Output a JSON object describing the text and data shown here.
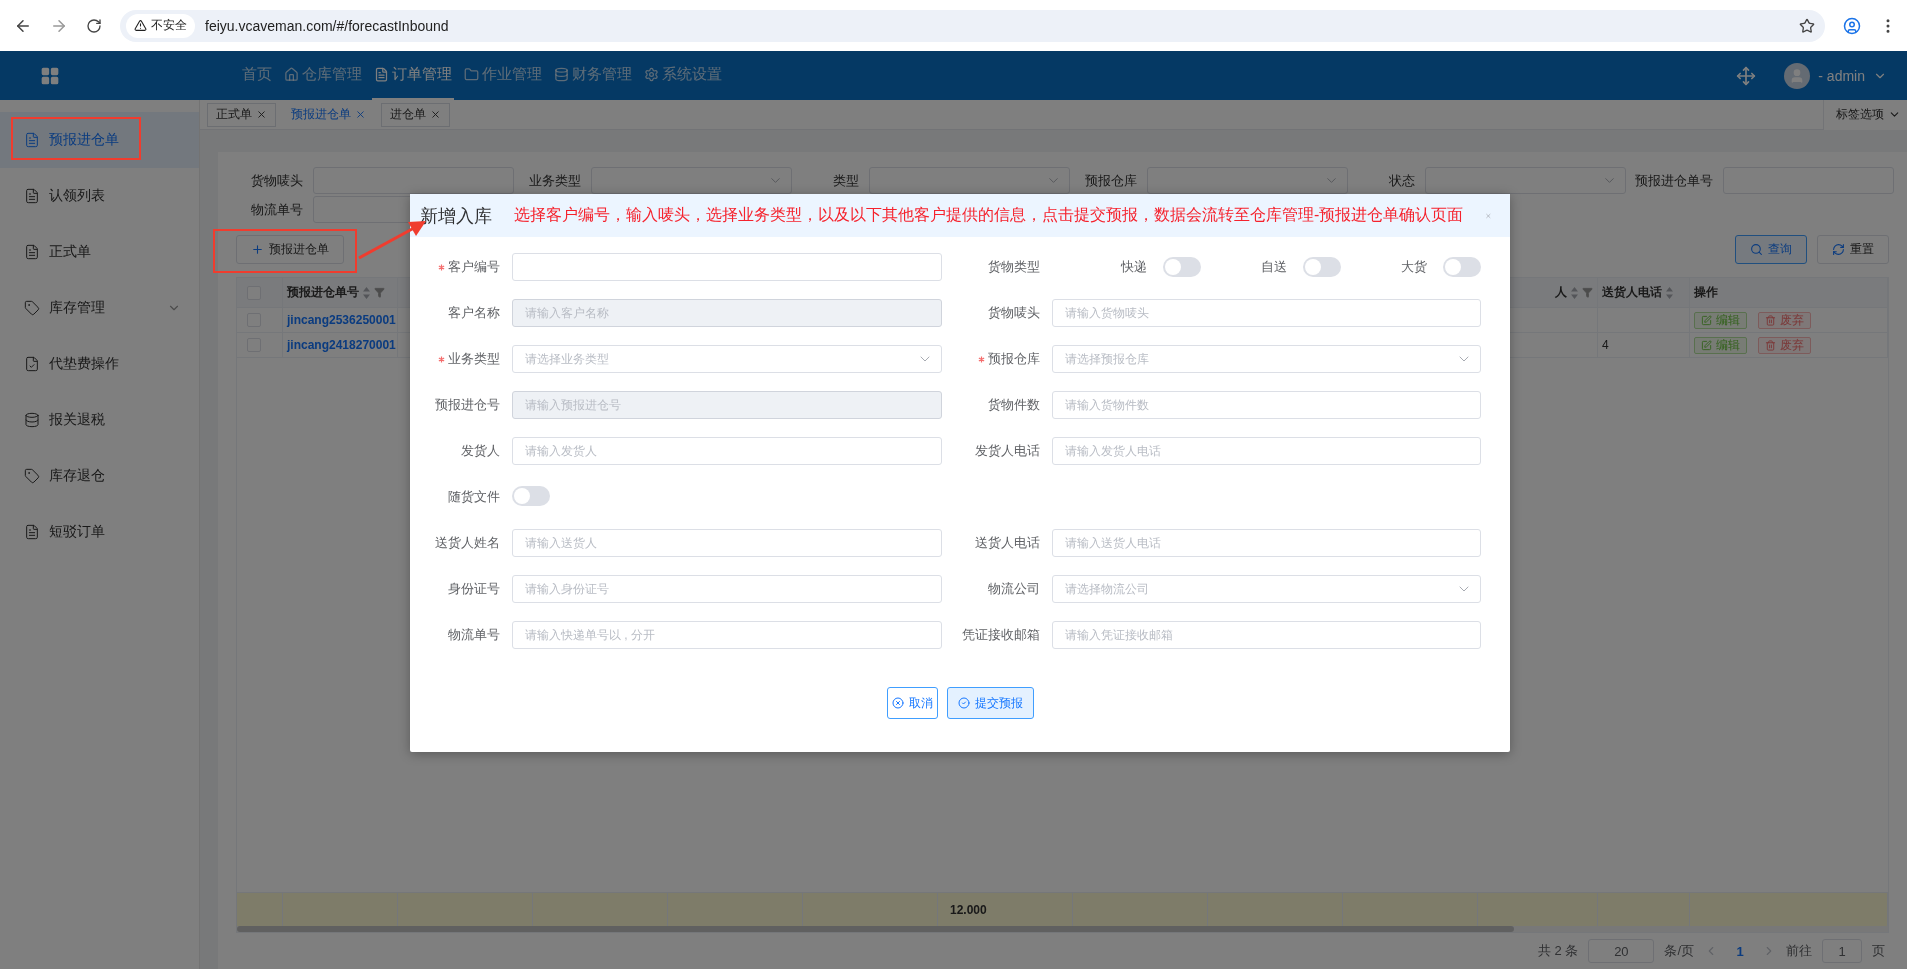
{
  "browser": {
    "security": "不安全",
    "url": "feiyu.vcaveman.com/#/forecastInbound"
  },
  "header": {
    "nav": [
      {
        "label": "首页",
        "selected": false
      },
      {
        "label": "仓库管理",
        "selected": false
      },
      {
        "label": "订单管理",
        "selected": true
      },
      {
        "label": "作业管理",
        "selected": false
      },
      {
        "label": "财务管理",
        "selected": false
      },
      {
        "label": "系统设置",
        "selected": false
      }
    ],
    "user": "- admin"
  },
  "sidebar": {
    "items": [
      {
        "label": "预报进仓单",
        "selected": true,
        "expandable": false
      },
      {
        "label": "认领列表",
        "selected": false,
        "expandable": false
      },
      {
        "label": "正式单",
        "selected": false,
        "expandable": false
      },
      {
        "label": "库存管理",
        "selected": false,
        "expandable": true
      },
      {
        "label": "代垫费操作",
        "selected": false,
        "expandable": false
      },
      {
        "label": "报关退税",
        "selected": false,
        "expandable": false
      },
      {
        "label": "库存退仓",
        "selected": false,
        "expandable": false
      },
      {
        "label": "短驳订单",
        "selected": false,
        "expandable": false
      }
    ]
  },
  "tabs": {
    "items": [
      {
        "label": "正式单",
        "selected": false
      },
      {
        "label": "预报进仓单",
        "selected": true
      },
      {
        "label": "进仓单",
        "selected": false
      }
    ],
    "options": "标签选项"
  },
  "filters": [
    {
      "label": "货物唛头",
      "kind": "input"
    },
    {
      "label": "业务类型",
      "kind": "select"
    },
    {
      "label": "类型",
      "kind": "select"
    },
    {
      "label": "预报仓库",
      "kind": "select"
    },
    {
      "label": "状态",
      "kind": "select"
    },
    {
      "label": "预报进仓单号",
      "kind": "input"
    },
    {
      "label": "物流单号",
      "kind": "input"
    }
  ],
  "actions": {
    "add": "预报进仓单",
    "search": "查询",
    "reset": "重置"
  },
  "table": {
    "select_all": false,
    "columns": [
      "预报进仓单号",
      "人",
      "送货人电话",
      "操作"
    ],
    "rows": [
      {
        "selected": false,
        "number": "jincang2536250001",
        "actions": [
          {
            "label": "编辑",
            "kind": "edit"
          },
          {
            "label": "废弃",
            "kind": "discard"
          }
        ]
      },
      {
        "selected": false,
        "number": "jincang2418270001",
        "phone": "4",
        "actions": [
          {
            "label": "编辑",
            "kind": "edit"
          },
          {
            "label": "废弃",
            "kind": "discard"
          }
        ]
      }
    ],
    "summary": "12.000"
  },
  "pagination": {
    "total": "共 2 条",
    "page_size": "20",
    "per_page": "条/页",
    "pages": [
      {
        "label": "1",
        "selected": true
      }
    ],
    "goto": "前往",
    "goto_value": "1",
    "page_unit": "页"
  },
  "dialog": {
    "title": "新增入库",
    "note": "选择客户编号，输入唛头，选择业务类型，以及以下其他客户提供的信息，点击提交预报，数据会流转至仓库管理-预报进仓单确认页面",
    "fields": [
      {
        "label": "客户编号",
        "kind": "input",
        "required": true,
        "disabled": false
      },
      {
        "label": "货物类型",
        "kind": "switches",
        "required": false,
        "options": [
          {
            "label": "快递",
            "on": false
          },
          {
            "label": "自送",
            "on": false
          },
          {
            "label": "大货",
            "on": false
          }
        ]
      },
      {
        "label": "客户名称",
        "kind": "input",
        "placeholder": "请输入客户名称",
        "required": false,
        "disabled": true
      },
      {
        "label": "货物唛头",
        "kind": "input",
        "placeholder": "请输入货物唛头",
        "required": false,
        "disabled": false
      },
      {
        "label": "业务类型",
        "kind": "select",
        "placeholder": "请选择业务类型",
        "required": true
      },
      {
        "label": "预报仓库",
        "kind": "select",
        "placeholder": "请选择预报仓库",
        "required": true
      },
      {
        "label": "预报进仓号",
        "kind": "input",
        "placeholder": "请输入预报进仓号",
        "required": false,
        "disabled": true
      },
      {
        "label": "货物件数",
        "kind": "input",
        "placeholder": "请输入货物件数",
        "required": false,
        "disabled": false
      },
      {
        "label": "发货人",
        "kind": "input",
        "placeholder": "请输入发货人",
        "required": false,
        "disabled": false
      },
      {
        "label": "发货人电话",
        "kind": "input",
        "placeholder": "请输入发货人电话",
        "required": false,
        "disabled": false
      },
      {
        "label": "随货文件",
        "kind": "switch",
        "required": false,
        "on": false
      },
      {
        "label": "送货人姓名",
        "kind": "input",
        "placeholder": "请输入送货人",
        "required": false,
        "disabled": false
      },
      {
        "label": "送货人电话",
        "kind": "input",
        "placeholder": "请输入送货人电话",
        "required": false,
        "disabled": false
      },
      {
        "label": "身份证号",
        "kind": "input",
        "placeholder": "请输入身份证号",
        "required": false,
        "disabled": false
      },
      {
        "label": "物流公司",
        "kind": "select",
        "placeholder": "请选择物流公司",
        "required": false
      },
      {
        "label": "物流单号",
        "kind": "input",
        "placeholder": "请输入快递单号以 , 分开",
        "required": false,
        "disabled": false
      },
      {
        "label": "凭证接收邮箱",
        "kind": "input",
        "placeholder": "请输入凭证接收邮箱",
        "required": false,
        "disabled": false
      }
    ],
    "buttons": [
      {
        "label": "取消",
        "kind": "cancel"
      },
      {
        "label": "提交预报",
        "kind": "submit"
      }
    ]
  }
}
